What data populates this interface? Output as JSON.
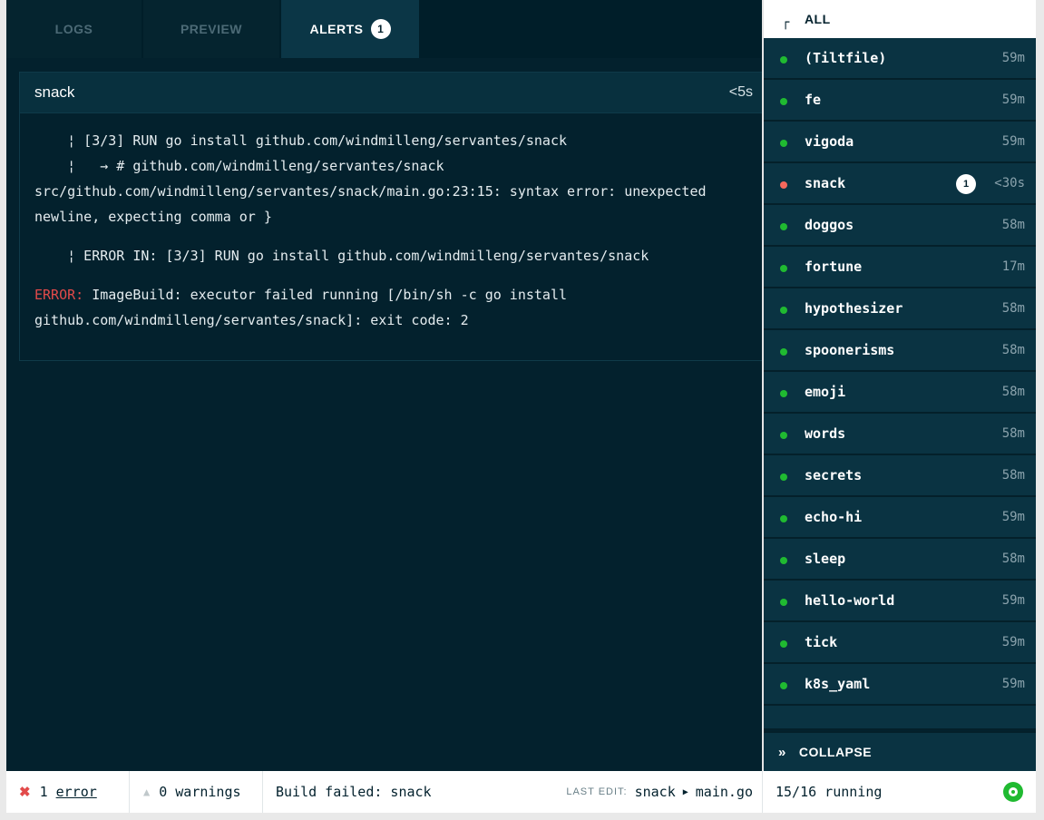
{
  "tabs": [
    {
      "label": "LOGS"
    },
    {
      "label": "PREVIEW"
    },
    {
      "label": "ALERTS",
      "badge": "1",
      "active": true
    }
  ],
  "alert": {
    "resource": "snack",
    "time": "<5s",
    "lines": [
      "    ¦ [3/3] RUN go install github.com/windmilleng/servantes/snack",
      "    ¦   → # github.com/windmilleng/servantes/snack",
      "src/github.com/windmilleng/servantes/snack/main.go:23:15: syntax error: unexpected",
      "newline, expecting comma or }",
      "    ¦ ERROR IN: [3/3] RUN go install github.com/windmilleng/servantes/snack",
      "ImageBuild: executor failed running [/bin/sh -c go install",
      "github.com/windmilleng/servantes/snack]: exit code: 2"
    ],
    "error_prefix": "ERROR:"
  },
  "sidebar": {
    "all_label": "ALL",
    "all_corner": "┌",
    "items": [
      {
        "name": "(Tiltfile)",
        "time": "59m",
        "status": "ok"
      },
      {
        "name": "fe",
        "time": "59m",
        "status": "ok"
      },
      {
        "name": "vigoda",
        "time": "59m",
        "status": "ok"
      },
      {
        "name": "snack",
        "time": "<30s",
        "status": "error",
        "badge": "1"
      },
      {
        "name": "doggos",
        "time": "58m",
        "status": "ok"
      },
      {
        "name": "fortune",
        "time": "17m",
        "status": "ok"
      },
      {
        "name": "hypothesizer",
        "time": "58m",
        "status": "ok"
      },
      {
        "name": "spoonerisms",
        "time": "58m",
        "status": "ok"
      },
      {
        "name": "emoji",
        "time": "58m",
        "status": "ok"
      },
      {
        "name": "words",
        "time": "58m",
        "status": "ok"
      },
      {
        "name": "secrets",
        "time": "58m",
        "status": "ok"
      },
      {
        "name": "echo-hi",
        "time": "59m",
        "status": "ok"
      },
      {
        "name": "sleep",
        "time": "58m",
        "status": "ok"
      },
      {
        "name": "hello-world",
        "time": "59m",
        "status": "ok"
      },
      {
        "name": "tick",
        "time": "59m",
        "status": "ok"
      },
      {
        "name": "k8s_yaml",
        "time": "59m",
        "status": "ok"
      }
    ],
    "collapse_label": "COLLAPSE",
    "collapse_icon": "»"
  },
  "statusbar": {
    "error_icon": "✖",
    "error_count": "1",
    "error_label": "error",
    "warning_icon": "▲",
    "warning_count": "0",
    "warning_label": "warnings",
    "build_status": "Build failed: snack",
    "last_edit_label": "LAST EDIT:",
    "last_edit_resource": "snack",
    "last_edit_arrow": "▶",
    "last_edit_file": "main.go",
    "running": "15/16 running"
  },
  "colors": {
    "background": "#03212d",
    "ok": "#20ba31",
    "error": "#f6685c",
    "error_text": "#e24a4a"
  }
}
